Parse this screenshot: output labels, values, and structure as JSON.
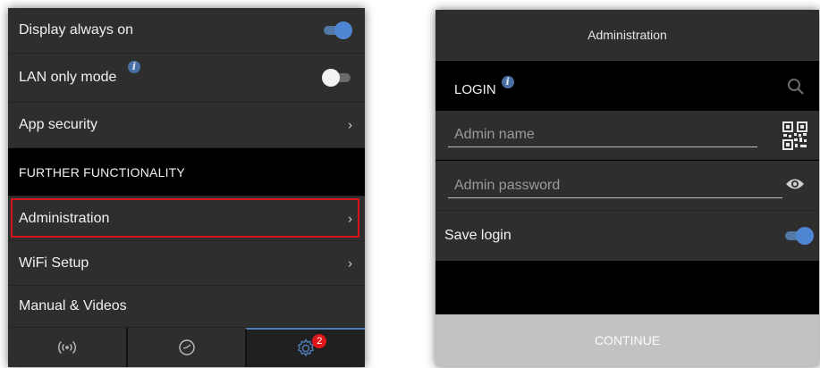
{
  "settings_list": {
    "items": [
      {
        "label": "Display always on"
      },
      {
        "label": "LAN only mode"
      },
      {
        "label": "App security"
      },
      {
        "label": "FURTHER FUNCTIONALITY"
      },
      {
        "label": "Administration"
      },
      {
        "label": "WiFi Setup"
      },
      {
        "label": "Manual & Videos"
      }
    ],
    "toggles": {
      "display_always_on": "on",
      "lan_only_mode": "off"
    }
  },
  "tab_bar": {
    "tabs": [
      {
        "icon": "signal-icon"
      },
      {
        "icon": "gauge-icon"
      },
      {
        "icon": "settings-gear-icon",
        "badge": "2"
      }
    ],
    "active_index": 2
  },
  "admin_panel": {
    "header_title": "Administration",
    "login_label": "LOGIN",
    "admin_name_placeholder": "Admin name",
    "admin_password_placeholder": "Admin password",
    "save_login_label": "Save login",
    "save_login_toggle": "on",
    "continue_label": "CONTINUE"
  },
  "colors": {
    "accent": "#4f86d3",
    "highlight": "#d6141c",
    "badge": "#e0161b",
    "row_bg": "#2e2e2e"
  }
}
